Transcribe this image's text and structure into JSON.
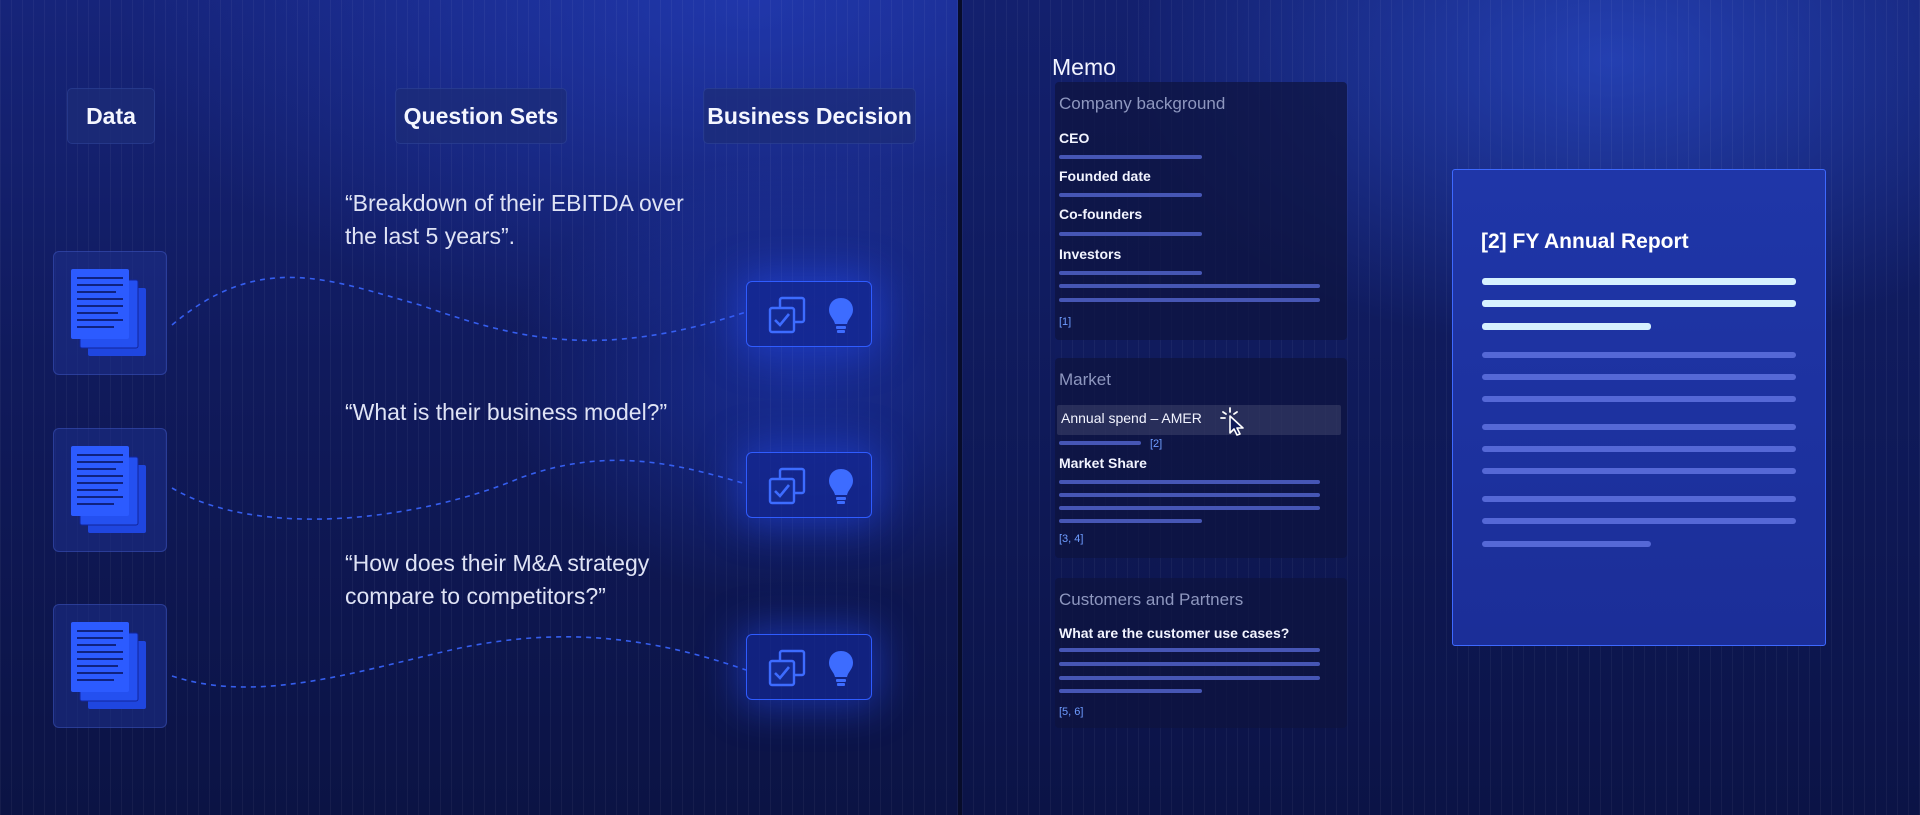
{
  "columns": {
    "data": "Data",
    "question_sets": "Question Sets",
    "business_decision": "Business Decision"
  },
  "questions": [
    "“Breakdown of their EBITDA over the last 5 years”.",
    "“What is their business model?”",
    "“How does their M&A strategy compare to competitors?”"
  ],
  "icons": {
    "data_card": "document-stack-icon",
    "decision_check": "checklist-icon",
    "decision_idea": "lightbulb-icon"
  },
  "memo": {
    "title": "Memo",
    "company_background": {
      "heading": "Company background",
      "fields": [
        "CEO",
        "Founded date",
        "Co-founders",
        "Investors"
      ],
      "ref": "[1]"
    },
    "market": {
      "heading": "Market",
      "highlighted": "Annual spend – AMER",
      "highlight_ref": "[2]",
      "field": "Market Share",
      "ref": "[3, 4]"
    },
    "customers": {
      "heading": "Customers and Partners",
      "field": "What are the customer use cases?",
      "ref": "[5, 6]"
    }
  },
  "report": {
    "title": "[2] FY Annual Report"
  },
  "colors": {
    "accent": "#2f5cff",
    "highlight_bar": "#d6f1ff",
    "ref_link": "#6e9cff"
  }
}
